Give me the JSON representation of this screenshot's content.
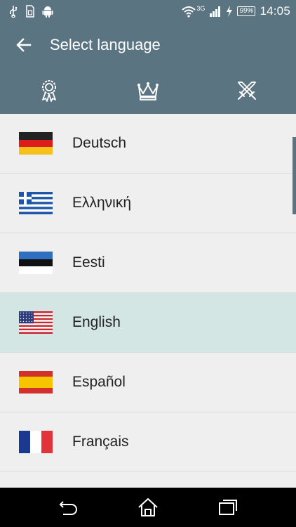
{
  "status_bar": {
    "time": "14:05",
    "battery": "99%",
    "network": "3G",
    "icons": [
      "usb-icon",
      "sim-icon",
      "android-icon",
      "wifi-icon",
      "signal-icon",
      "charging-icon"
    ]
  },
  "app_bar": {
    "title": "Select language",
    "back_icon": "arrow-left-icon",
    "tabs": [
      {
        "icon": "ribbon-award-icon"
      },
      {
        "icon": "crown-icon"
      },
      {
        "icon": "crossed-swords-icon"
      }
    ]
  },
  "languages": [
    {
      "label": "Deutsch",
      "flag": "germany",
      "selected": false
    },
    {
      "label": "Ελληνική",
      "flag": "greece",
      "selected": false
    },
    {
      "label": "Eesti",
      "flag": "estonia",
      "selected": false
    },
    {
      "label": "English",
      "flag": "usa",
      "selected": true
    },
    {
      "label": "Español",
      "flag": "spain",
      "selected": false
    },
    {
      "label": "Français",
      "flag": "france",
      "selected": false
    },
    {
      "label": "",
      "flag": "partial",
      "selected": false
    }
  ],
  "colors": {
    "accent": "#5b7481",
    "selected_row": "#d4e6e4",
    "list_bg": "#efefef"
  },
  "nav_bar": {
    "buttons": [
      "back-icon",
      "home-icon",
      "recents-icon"
    ]
  }
}
